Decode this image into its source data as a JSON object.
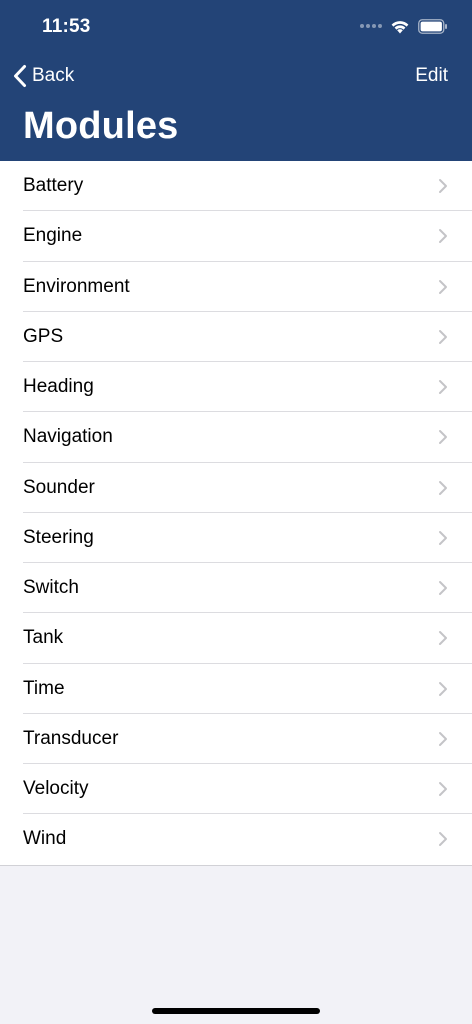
{
  "status_bar": {
    "time": "11:53"
  },
  "nav": {
    "back_label": "Back",
    "edit_label": "Edit",
    "title": "Modules"
  },
  "modules": [
    {
      "label": "Battery"
    },
    {
      "label": "Engine"
    },
    {
      "label": "Environment"
    },
    {
      "label": "GPS"
    },
    {
      "label": "Heading"
    },
    {
      "label": "Navigation"
    },
    {
      "label": "Sounder"
    },
    {
      "label": "Steering"
    },
    {
      "label": "Switch"
    },
    {
      "label": "Tank"
    },
    {
      "label": "Time"
    },
    {
      "label": "Transducer"
    },
    {
      "label": "Velocity"
    },
    {
      "label": "Wind"
    }
  ],
  "colors": {
    "header_background": "#234477",
    "list_background": "#ffffff",
    "page_background": "#f2f2f7",
    "chevron": "#c4c4c7"
  }
}
